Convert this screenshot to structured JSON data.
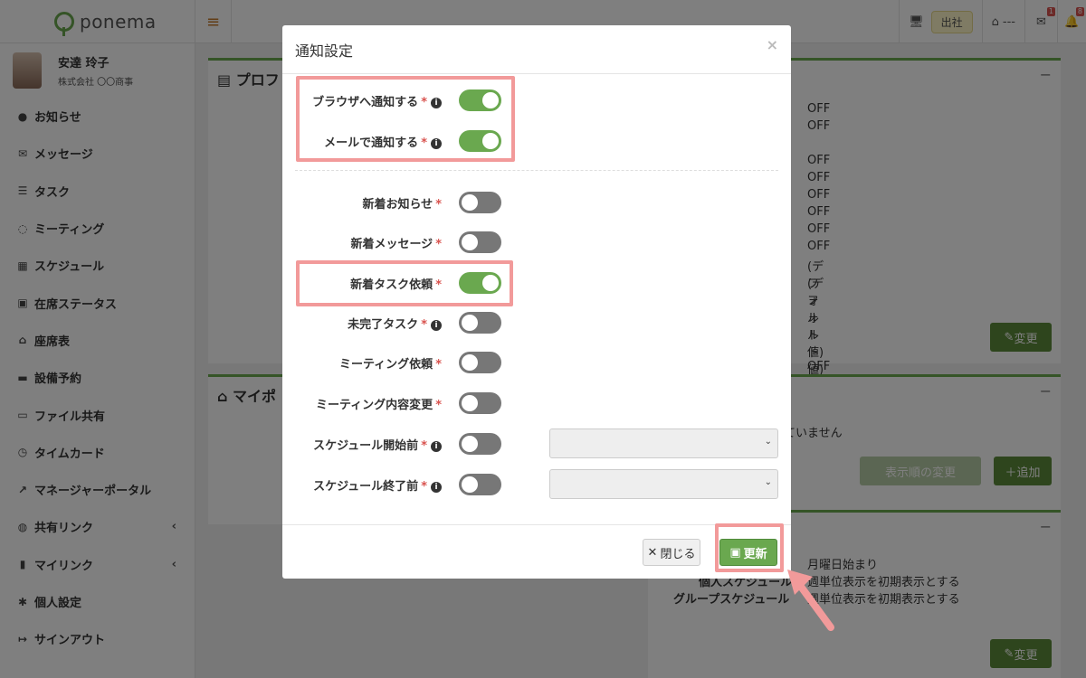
{
  "app": {
    "logo_text": "ponema",
    "menu_icon": "hamburger-icon"
  },
  "topbar": {
    "status_label": "出社",
    "seat_label": "---",
    "mail_badge": "1",
    "bell_badge": "8"
  },
  "user": {
    "name": "安達 玲子",
    "company": "株式会社 〇〇商事"
  },
  "sidebar": {
    "items": [
      {
        "label": "お知らせ",
        "icon": "info-icon"
      },
      {
        "label": "メッセージ",
        "icon": "mail-icon"
      },
      {
        "label": "タスク",
        "icon": "tasks-icon"
      },
      {
        "label": "ミーティング",
        "icon": "comments-icon"
      },
      {
        "label": "スケジュール",
        "icon": "calendar-icon"
      },
      {
        "label": "在席ステータス",
        "icon": "presence-icon"
      },
      {
        "label": "座席表",
        "icon": "seat-icon"
      },
      {
        "label": "設備予約",
        "icon": "equipment-icon"
      },
      {
        "label": "ファイル共有",
        "icon": "folder-icon"
      },
      {
        "label": "タイムカード",
        "icon": "clock-icon"
      },
      {
        "label": "マネージャーポータル",
        "icon": "chart-icon"
      },
      {
        "label": "共有リンク",
        "icon": "globe-icon"
      },
      {
        "label": "マイリンク",
        "icon": "bookmark-icon"
      },
      {
        "label": "個人設定",
        "icon": "gear-icon"
      },
      {
        "label": "サインアウト",
        "icon": "signout-icon"
      }
    ]
  },
  "bg": {
    "profile_title": "プロフ",
    "home_title": "マイポ",
    "off_values": [
      "OFF",
      "OFF",
      "OFF",
      "OFF",
      "OFF",
      "OFF",
      "OFF",
      "OFF"
    ],
    "default_off": [
      "(デフォルト値) OFF",
      "(デフォルト値) OFF"
    ],
    "change_label": "変更",
    "empty_text": "ていません",
    "display_change_label": "表示順の変更",
    "add_label": "追加",
    "week_start": "月曜日始まり",
    "personal_schedule_label": "個人スケジュール",
    "personal_schedule_value": "週単位表示を初期表示とする",
    "group_schedule_label": "グループスケジュール",
    "group_schedule_value": "週単位表示を初期表示とする"
  },
  "modal": {
    "title": "通知設定",
    "rows": [
      {
        "label": "ブラウザへ通知する",
        "required": "*",
        "on": true,
        "info": true
      },
      {
        "label": "メールで通知する",
        "required": "*",
        "on": true,
        "info": true
      },
      {
        "label": "新着お知らせ",
        "required": "*",
        "on": false,
        "info": false
      },
      {
        "label": "新着メッセージ",
        "required": "*",
        "on": false,
        "info": false
      },
      {
        "label": "新着タスク依頼",
        "required": "*",
        "on": true,
        "info": false
      },
      {
        "label": "未完了タスク",
        "required": "*",
        "on": false,
        "info": true
      },
      {
        "label": "ミーティング依頼",
        "required": "*",
        "on": false,
        "info": false
      },
      {
        "label": "ミーティング内容変更",
        "required": "*",
        "on": false,
        "info": false
      },
      {
        "label": "スケジュール開始前",
        "required": "*",
        "on": false,
        "info": true
      },
      {
        "label": "スケジュール終了前",
        "required": "*",
        "on": false,
        "info": true
      }
    ],
    "close_label": "閉じる",
    "update_label": "更新"
  },
  "colors": {
    "accent": "#6aa84f",
    "highlight": "#f29a9a",
    "danger": "#d9534f"
  }
}
